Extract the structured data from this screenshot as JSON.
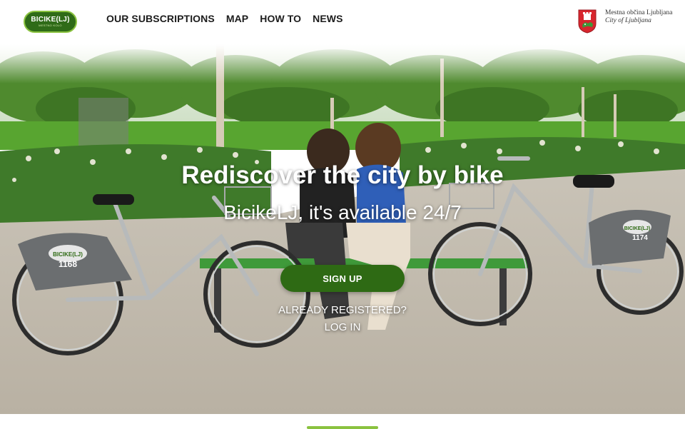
{
  "header": {
    "logo_text": "BICIKE(LJ)",
    "logo_sub": "MESTNO KOLO",
    "nav": [
      {
        "label": "OUR SUBSCRIPTIONS"
      },
      {
        "label": "MAP"
      },
      {
        "label": "HOW TO"
      },
      {
        "label": "NEWS"
      }
    ],
    "city_line1": "Mestna občina Ljubljana",
    "city_line2": "City of Ljubljana"
  },
  "hero": {
    "title": "Rediscover the city by bike",
    "subtitle": "BicikeLJ, it's available 24/7",
    "signup_label": "SIGN UP",
    "already_label": "ALREADY REGISTERED?",
    "login_label": "LOG IN",
    "bike_left_number": "1168",
    "bike_right_number": "1174",
    "bike_badge": "BICIKE(LJ)"
  },
  "colors": {
    "brand_green": "#2e6a14",
    "accent_lime": "#8ac23f"
  }
}
